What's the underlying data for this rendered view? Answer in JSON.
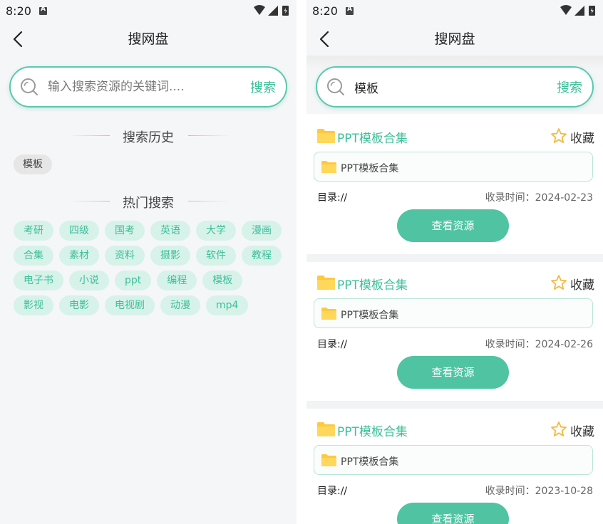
{
  "status_bar": {
    "time": "8:20"
  },
  "left_screen": {
    "nav": {
      "title": "搜网盘"
    },
    "search": {
      "placeholder": "输入搜索资源的关键词....",
      "button_label": "搜索"
    },
    "history": {
      "title": "搜索历史",
      "items": [
        "模板"
      ]
    },
    "hot": {
      "title": "热门搜索",
      "rows": [
        [
          "考研",
          "四级",
          "国考",
          "英语",
          "大学",
          "漫画"
        ],
        [
          "合集",
          "素材",
          "资料",
          "摄影",
          "软件",
          "教程"
        ],
        [
          "电子书",
          "小说",
          "ppt",
          "编程",
          "模板"
        ],
        [
          "影视",
          "电影",
          "电视剧",
          "动漫",
          "mp4"
        ]
      ]
    }
  },
  "right_screen": {
    "nav": {
      "title": "搜网盘"
    },
    "search": {
      "value": "模板",
      "button_label": "搜索"
    },
    "results": [
      {
        "title": "PPT模板合集",
        "favorite_label": "收藏",
        "file_name": "PPT模板合集",
        "directory": "目录://",
        "collected": "收录时间：2024-02-23",
        "button_label": "查看资源"
      },
      {
        "title": "PPT模板合集",
        "favorite_label": "收藏",
        "file_name": "PPT模板合集",
        "directory": "目录://",
        "collected": "收录时间：2024-02-26",
        "button_label": "查看资源"
      },
      {
        "title": "PPT模板合集",
        "favorite_label": "收藏",
        "file_name": "PPT模板合集",
        "directory": "目录://",
        "collected": "收录时间：2023-10-28",
        "button_label": "查看资源"
      }
    ]
  },
  "colors": {
    "accent": "#3fbf9a",
    "button": "#50c3a2",
    "tag_bg": "#d6f2e9",
    "folder": "#ffc83d",
    "star": "#f5b942"
  },
  "icons": [
    "back-arrow-icon",
    "search-icon",
    "folder-icon",
    "star-outline-icon",
    "wifi-icon",
    "signal-icon",
    "battery-icon"
  ]
}
